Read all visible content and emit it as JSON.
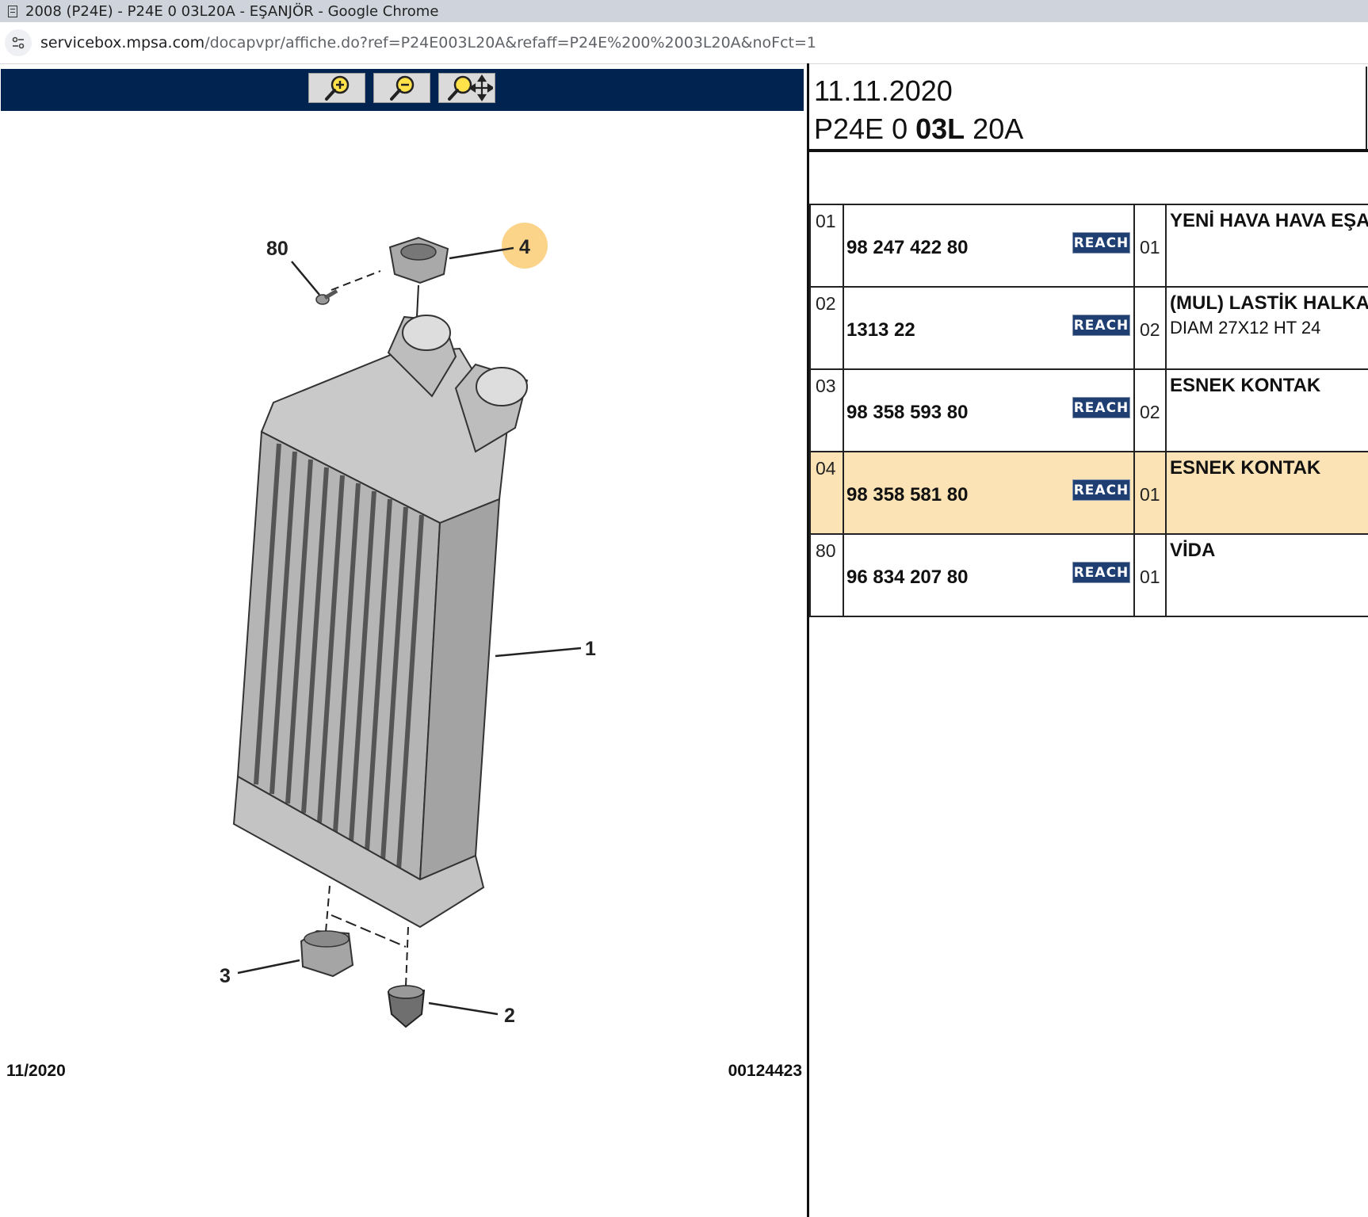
{
  "window": {
    "title": "2008 (P24E) - P24E 0 03L20A - EŞANJÖR - Google Chrome"
  },
  "address": {
    "host": "servicebox.mpsa.com",
    "path": "/docapvpr/affiche.do?ref=P24E003L20A&refaff=P24E%200%2003L20A&noFct=1"
  },
  "toolbar": {
    "buttons": [
      "zoom-in-icon",
      "zoom-out-icon",
      "zoom-pan-icon"
    ]
  },
  "diagram": {
    "callouts": {
      "c80": "80",
      "c4": "4",
      "c1": "1",
      "c3": "3",
      "c2": "2"
    },
    "highlight_color": "#fbd48a",
    "date": "11/2020",
    "code": "00124423"
  },
  "header": {
    "date": "11.11.2020",
    "ref_a": "P24E 0",
    "ref_b": "03L",
    "ref_c": "20A"
  },
  "parts": [
    {
      "idx": "01",
      "pn": "98 247 422 80",
      "reach": "REACH",
      "qty": "01",
      "d1": "YENİ HAVA HAVA EŞANJÖRÜ",
      "d2": ""
    },
    {
      "idx": "02",
      "pn": "1313 22",
      "reach": "REACH",
      "qty": "02",
      "d1": "(MUL) LASTİK HALKA",
      "d2": "DIAM 27X12 HT 24"
    },
    {
      "idx": "03",
      "pn": "98 358 593 80",
      "reach": "REACH",
      "qty": "02",
      "d1": "ESNEK KONTAK",
      "d2": ""
    },
    {
      "idx": "04",
      "pn": "98 358 581 80",
      "reach": "REACH",
      "qty": "01",
      "d1": "ESNEK KONTAK",
      "d2": ""
    },
    {
      "idx": "80",
      "pn": "96 834 207 80",
      "reach": "REACH",
      "qty": "01",
      "d1": "VİDA",
      "d2": ""
    }
  ],
  "colors": {
    "toolbar": "#002350",
    "highlight_row": "#fbe3b5",
    "reach_badge": "#1f3f73"
  }
}
